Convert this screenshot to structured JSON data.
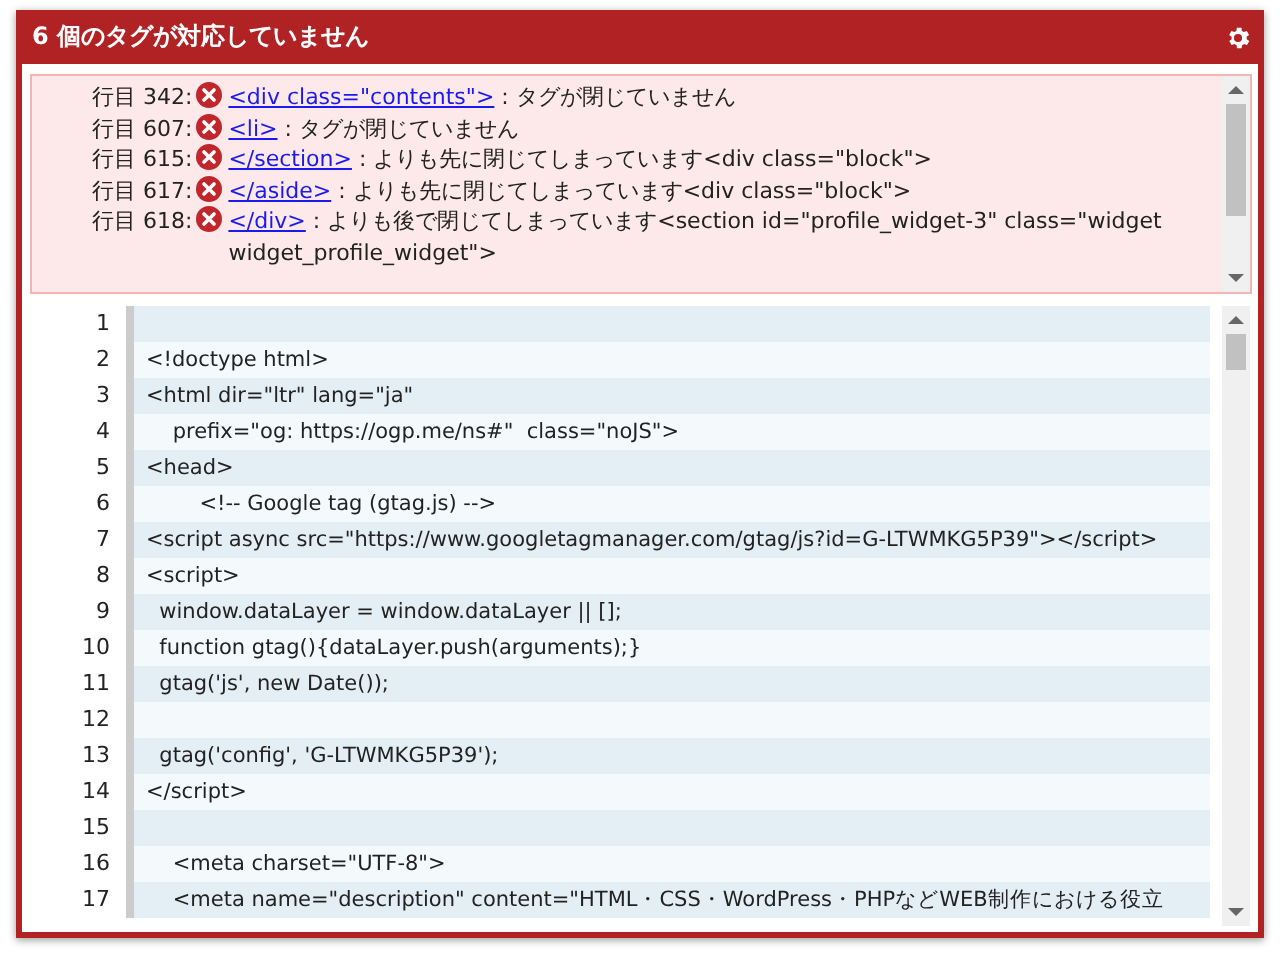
{
  "dialog": {
    "title": "6 個のタグが対応していません",
    "errors": [
      {
        "line_label": "行目 342:",
        "tag": "<div class=\"contents\">",
        "message": " : タグが閉じていません"
      },
      {
        "line_label": "行目 607:",
        "tag": "<li>",
        "message": " : タグが閉じていません"
      },
      {
        "line_label": "行目 615:",
        "tag": "</section>",
        "message": " : よりも先に閉じてしまっています<div class=\"block\">"
      },
      {
        "line_label": "行目 617:",
        "tag": "</aside>",
        "message": " : よりも先に閉じてしまっています<div class=\"block\">"
      },
      {
        "line_label": "行目 618:",
        "tag": "</div>",
        "message": " : よりも後で閉じてしまっています<section id=\"profile_widget-3\" class=\"widget widget_profile_widget\">"
      }
    ],
    "code_lines": [
      {
        "number": "1"
      },
      {
        "number": "2",
        "text": "<!doctype html>"
      },
      {
        "number": "3",
        "text": "<html dir=\"ltr\" lang=\"ja\""
      },
      {
        "number": "4",
        "text": "    prefix=\"og: https://ogp.me/ns#\"  class=\"noJS\">"
      },
      {
        "number": "5",
        "text": "<head>"
      },
      {
        "number": "6",
        "text": "        <!-- Google tag (gtag.js) -->"
      },
      {
        "number": "7",
        "text": "<script async src=\"https://www.googletagmanager.com/gtag/js?id=G-LTWMKG5P39\"></script>"
      },
      {
        "number": "8",
        "text": "<script>"
      },
      {
        "number": "9",
        "text": "  window.dataLayer = window.dataLayer || [];"
      },
      {
        "number": "10",
        "text": "  function gtag(){dataLayer.push(arguments);}"
      },
      {
        "number": "11",
        "text": "  gtag('js', new Date());"
      },
      {
        "number": "12"
      },
      {
        "number": "13",
        "text": "  gtag('config', 'G-LTWMKG5P39');"
      },
      {
        "number": "14",
        "text": "</script>"
      },
      {
        "number": "15"
      },
      {
        "number": "16",
        "text": "    <meta charset=\"UTF-8\">"
      },
      {
        "number": "17",
        "text": "    <meta name=\"description\" content=\"HTML・CSS・WordPress・PHPなどWEB制作における役立"
      }
    ]
  }
}
